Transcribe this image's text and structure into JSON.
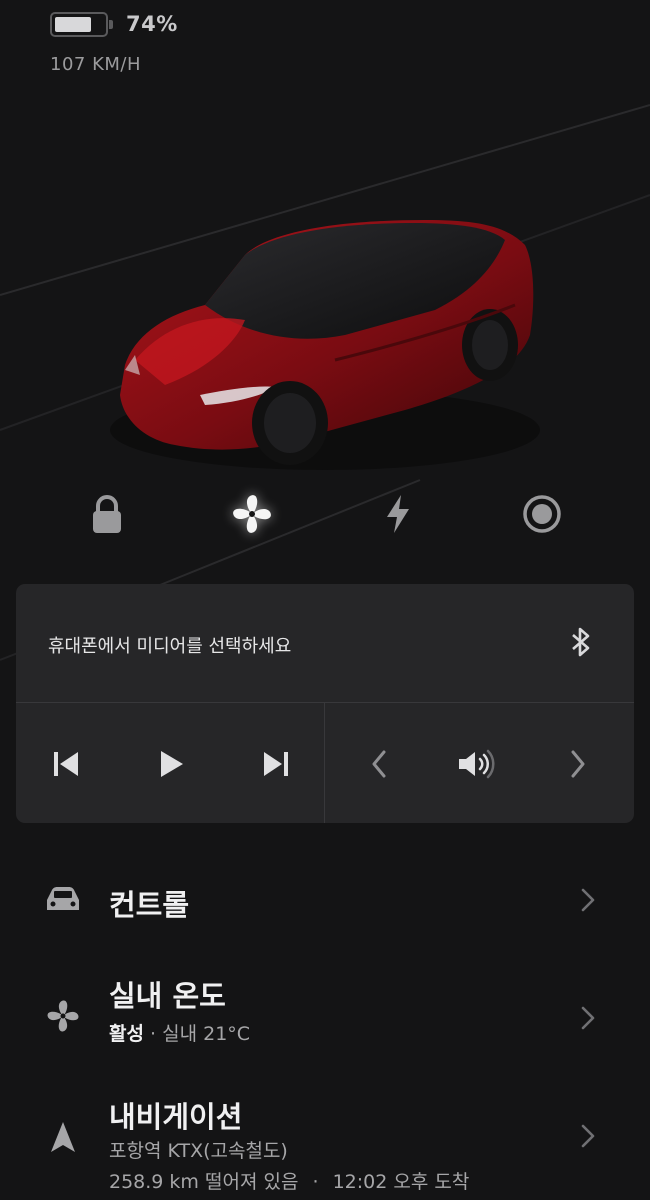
{
  "status": {
    "battery_percent": 74,
    "battery_label": "74%",
    "speed": "107 KM/H"
  },
  "vehicle": {
    "image": "red-model-x-car",
    "body_color": "#8a0f14"
  },
  "quick_controls": [
    {
      "name": "lock",
      "icon": "lock-icon"
    },
    {
      "name": "climate",
      "icon": "fan-icon",
      "active": true
    },
    {
      "name": "charge",
      "icon": "lightning-icon"
    },
    {
      "name": "sentry",
      "icon": "record-icon"
    }
  ],
  "media": {
    "prompt": "휴대폰에서 미디어를 선택하세요",
    "source_icon": "bluetooth-icon",
    "playback": [
      "previous-track-icon",
      "play-icon",
      "next-track-icon"
    ],
    "volume": [
      "chevron-left-icon",
      "volume-icon",
      "chevron-right-icon"
    ]
  },
  "menu": {
    "controls": {
      "title": "컨트롤",
      "icon": "car-icon"
    },
    "climate": {
      "title": "실내 온도",
      "status": "활성",
      "separator": "·",
      "detail": "실내 21°C",
      "icon": "fan-icon"
    },
    "navigation": {
      "title": "내비게이션",
      "destination": "포항역 KTX(고속철도)",
      "distance": "258.9 km 떨어져 있음",
      "separator": "·",
      "eta": "12:02 오후 도착",
      "icon": "navigation-arrow-icon"
    }
  },
  "colors": {
    "background": "#141415",
    "card": "#262628",
    "text": "#e9e9ea",
    "muted": "#a6a6a8",
    "accent_car": "#8a0f14"
  }
}
